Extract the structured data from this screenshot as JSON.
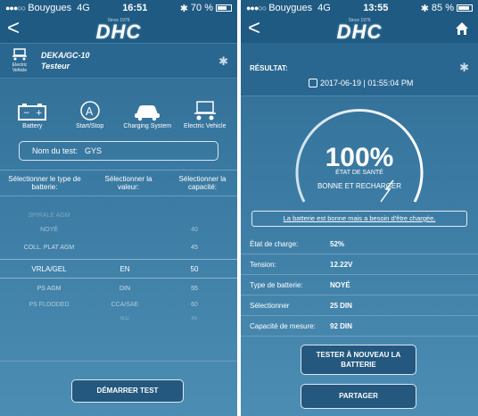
{
  "left": {
    "status": {
      "carrier": "Bouygues",
      "network": "4G",
      "time": "16:51",
      "battery": "70 %",
      "battery_pct": 0.7
    },
    "brand": {
      "since": "Since 1976",
      "name": "DHC"
    },
    "tester": {
      "model": "DEKA/GC-10",
      "label": "Testeur",
      "ev_label": "Electric Vehicle"
    },
    "modes": [
      {
        "label": "Battery",
        "icon": "battery-icon"
      },
      {
        "label": "Start/Stop",
        "icon": "start-stop-icon"
      },
      {
        "label": "Charging System",
        "icon": "charging-car-icon"
      },
      {
        "label": "Electric Vehicle",
        "icon": "electric-vehicle-icon"
      }
    ],
    "test_name": {
      "label": "Nom du test:",
      "value": "GYS"
    },
    "columns": {
      "type": "Sélectionner le type de batterie:",
      "value": "Sélectionner la valeur:",
      "capacity": "Sélectionner la capacité:"
    },
    "picker": {
      "types": [
        "SPIRALE AGM",
        "NOYÉ",
        "COLL. PLAT AGM",
        "VRLA/GEL",
        "PS AGM",
        "PS FLOODED"
      ],
      "standards": [
        "EN",
        "DIN",
        "CCA/SAE",
        "IEC"
      ],
      "capacities": [
        "40",
        "45",
        "50",
        "55",
        "60",
        "65"
      ],
      "selected": {
        "type": "VRLA/GEL",
        "standard": "EN",
        "capacity": "50"
      }
    },
    "start_button": "DÉMARRER TEST"
  },
  "right": {
    "status": {
      "carrier": "Bouygues",
      "network": "4G",
      "time": "13:55",
      "battery": "85 %",
      "battery_pct": 0.85
    },
    "brand": {
      "since": "Since 1976",
      "name": "DHC"
    },
    "result_label": "RÉSULTAT:",
    "datetime": "2017-06-19 | 01:55:04 PM",
    "health": {
      "percent": "100%",
      "percent_value": 100,
      "state_label": "ÉTAT DE SANTÉ",
      "condition": "BONNE ET RECHARGER"
    },
    "message": "La batterie est bonne mais a besoin d'être chargée.",
    "details": [
      {
        "key": "État de charge:",
        "value": "52%"
      },
      {
        "key": "Tension:",
        "value": "12.22V"
      },
      {
        "key": "Type de batterie:",
        "value": "NOYÉ"
      },
      {
        "key": "Sélectionner",
        "value": "25 DIN"
      },
      {
        "key": "Capacité de mesure:",
        "value": "92 DIN"
      }
    ],
    "retest_button": "TESTER À NOUVEAU LA BATTERIE",
    "share_button": "PARTAGER"
  }
}
